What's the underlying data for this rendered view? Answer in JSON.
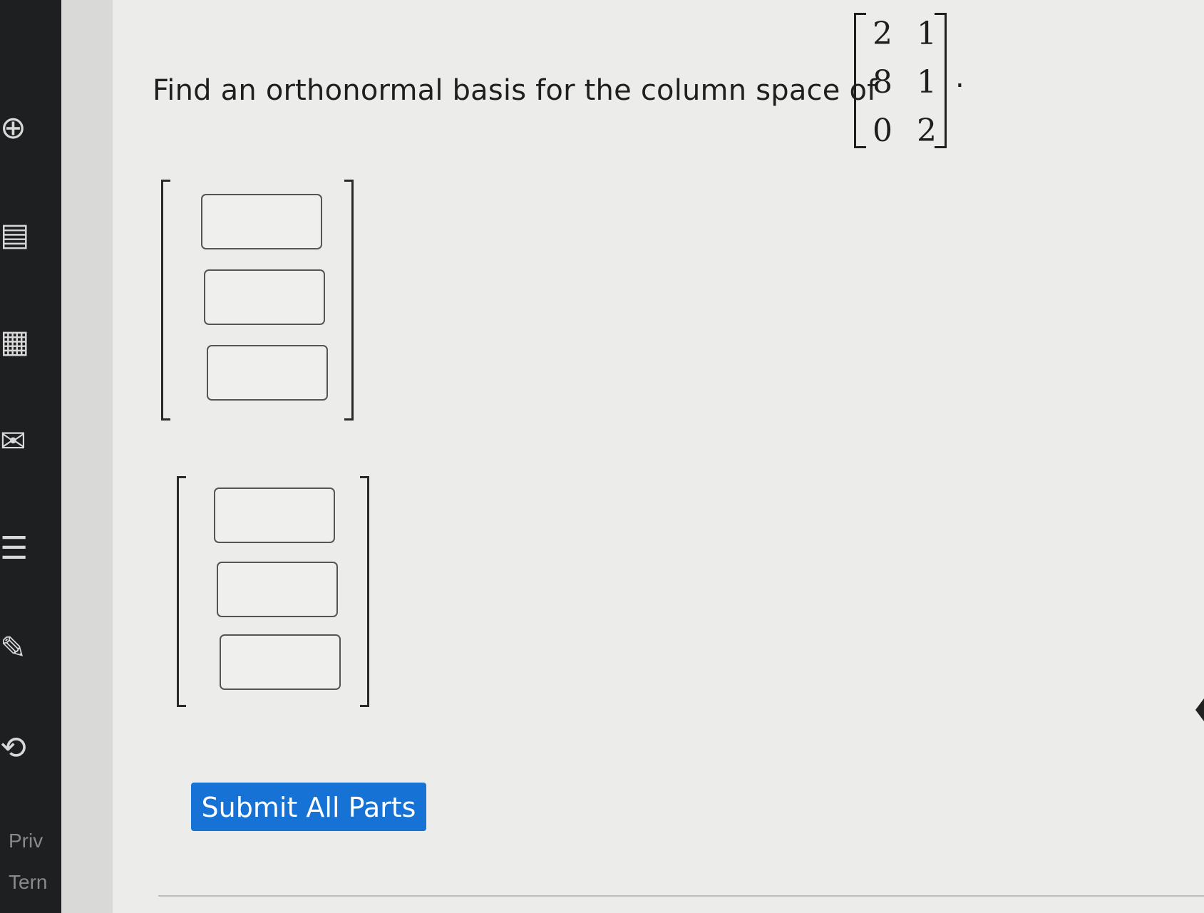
{
  "question": {
    "text": "Find an orthonormal basis for the column space of",
    "matrix": [
      [
        "2",
        "1"
      ],
      [
        "8",
        "1"
      ],
      [
        "0",
        "2"
      ]
    ],
    "trailing": "."
  },
  "answer": {
    "vectors": [
      {
        "entries": [
          "",
          "",
          ""
        ]
      },
      {
        "entries": [
          "",
          "",
          ""
        ]
      }
    ]
  },
  "submit_label": "Submit All Parts",
  "sidebar": {
    "icons": [
      "grid-icon",
      "document-icon",
      "list-icon",
      "mail-icon",
      "notes-icon",
      "edit-icon",
      "logout-icon"
    ],
    "footer_links": [
      "Priv",
      "Tern"
    ]
  },
  "colors": {
    "accent": "#1672d4",
    "background": "#ececea",
    "sidebar": "#1e1f21"
  }
}
